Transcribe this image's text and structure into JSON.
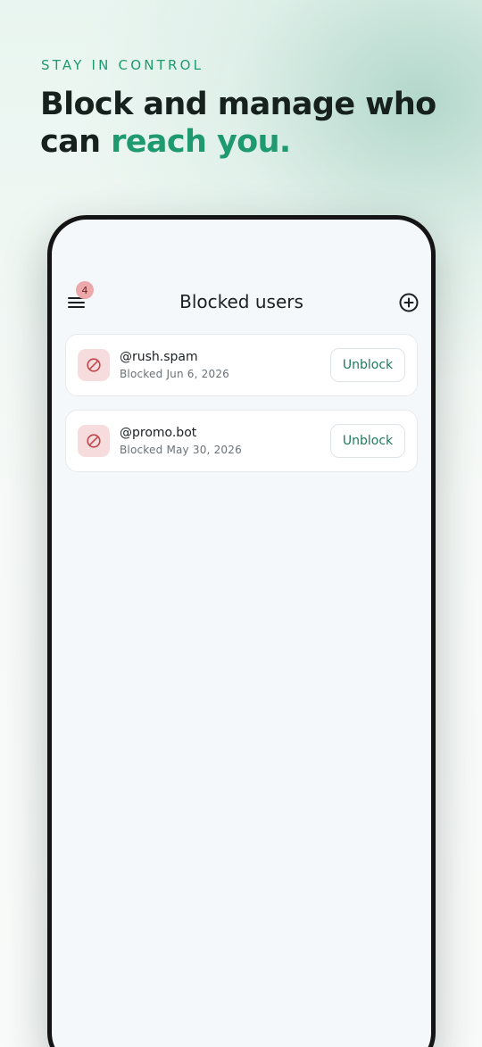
{
  "promo": {
    "eyebrow": "STAY IN CONTROL",
    "headline_line1": "Block and manage who",
    "headline_line2_prefix": "can ",
    "headline_accent": "reach you."
  },
  "appbar": {
    "title": "Blocked users",
    "menu_badge_count": "4",
    "menu_icon": "hamburger-menu-icon",
    "add_icon": "plus-circle-icon"
  },
  "blocked_users": [
    {
      "handle": "@rush.spam",
      "blocked_label": "Blocked Jun 6, 2026",
      "action": "Unblock",
      "icon": "ban-icon"
    },
    {
      "handle": "@promo.bot",
      "blocked_label": "Blocked May 30, 2026",
      "action": "Unblock",
      "icon": "ban-icon"
    }
  ],
  "colors": {
    "accent": "#1f9a70",
    "badge": "#eba9a9",
    "ban_tile": "#f6dcdc",
    "ban_stroke": "#c0474b",
    "unblock_text": "#1f7a5a"
  }
}
